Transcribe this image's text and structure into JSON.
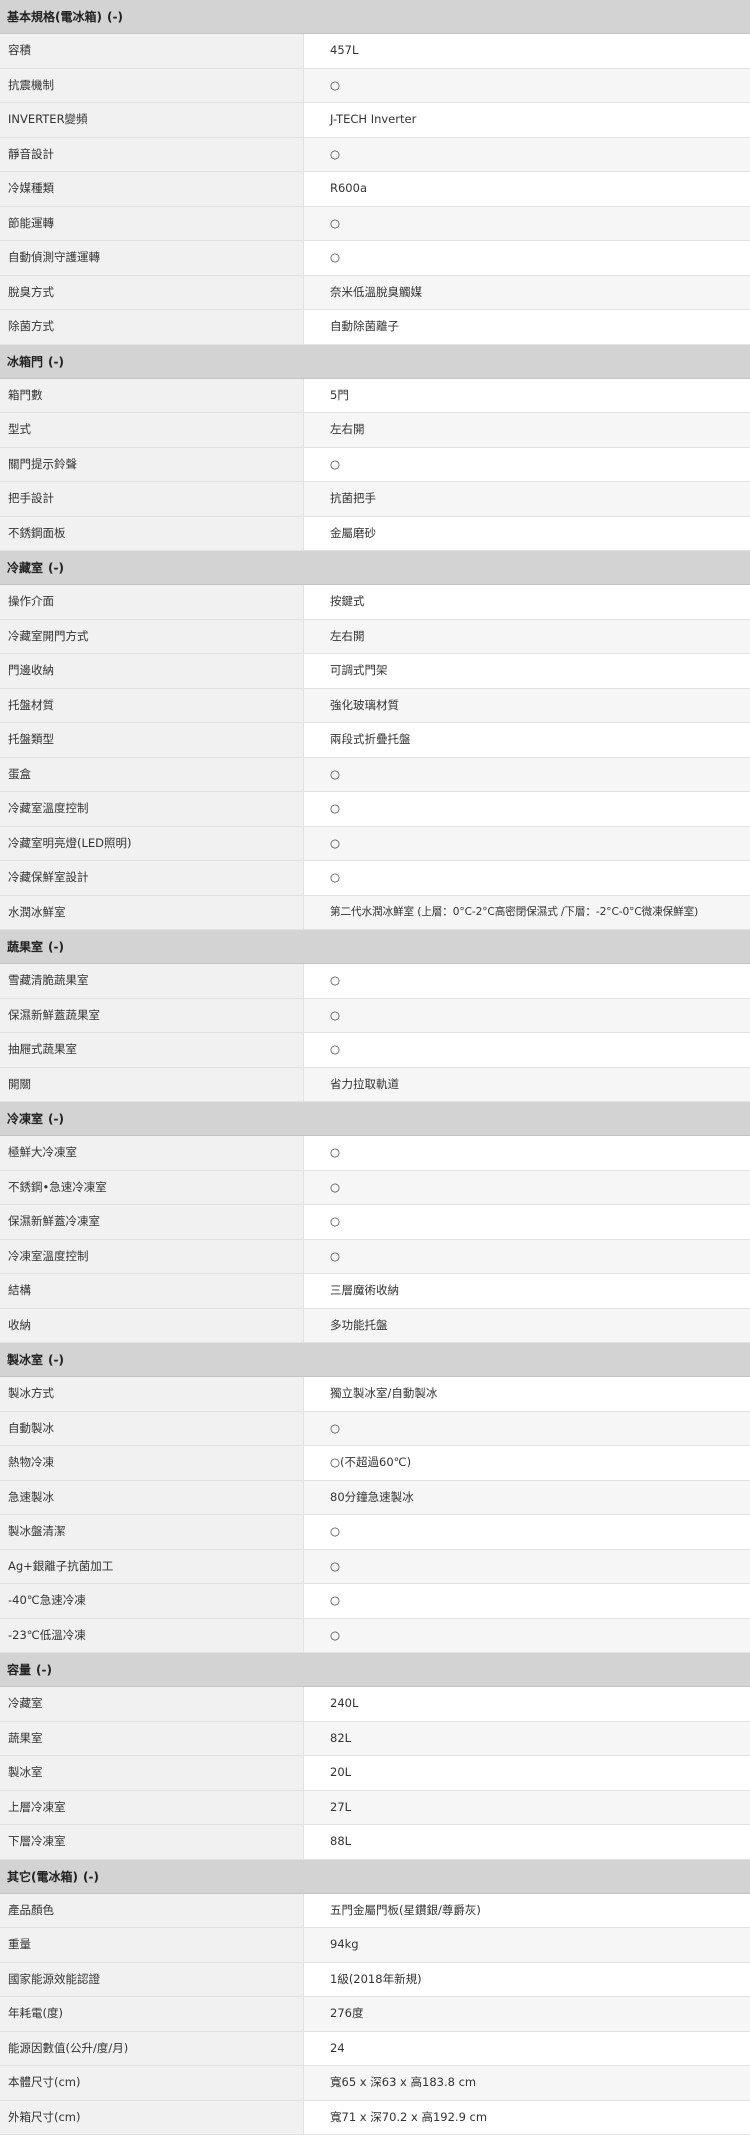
{
  "sections": [
    {
      "title": "基本規格(電冰箱)",
      "toggle": "(-)",
      "rows": [
        {
          "label": "容積",
          "value": "457L"
        },
        {
          "label": "抗震機制",
          "value": "○"
        },
        {
          "label": "INVERTER變頻",
          "value": "J-TECH Inverter"
        },
        {
          "label": "靜音設計",
          "value": "○"
        },
        {
          "label": "冷媒種類",
          "value": "R600a"
        },
        {
          "label": "節能運轉",
          "value": "○"
        },
        {
          "label": "自動偵測守護運轉",
          "value": "○"
        },
        {
          "label": "脫臭方式",
          "value": "奈米低溫脫臭觸媒"
        },
        {
          "label": "除菌方式",
          "value": "自動除菌離子"
        }
      ]
    },
    {
      "title": "冰箱門",
      "toggle": "(-)",
      "rows": [
        {
          "label": "箱門數",
          "value": "5門"
        },
        {
          "label": "型式",
          "value": "左右開"
        },
        {
          "label": "關門提示鈴聲",
          "value": "○"
        },
        {
          "label": "把手設計",
          "value": "抗菌把手"
        },
        {
          "label": "不銹鋼面板",
          "value": "金屬磨砂"
        }
      ]
    },
    {
      "title": "冷藏室",
      "toggle": "(-)",
      "rows": [
        {
          "label": "操作介面",
          "value": "按鍵式"
        },
        {
          "label": "冷藏室開門方式",
          "value": "左右開"
        },
        {
          "label": "門邊收納",
          "value": "可調式門架"
        },
        {
          "label": "托盤材質",
          "value": "強化玻璃材質"
        },
        {
          "label": "托盤類型",
          "value": "兩段式折疊托盤"
        },
        {
          "label": "蛋盒",
          "value": "○"
        },
        {
          "label": "冷藏室溫度控制",
          "value": "○"
        },
        {
          "label": "冷藏室明亮燈(LED照明)",
          "value": "○"
        },
        {
          "label": "冷藏保鮮室設計",
          "value": "○"
        },
        {
          "label": "水潤冰鮮室",
          "value": "第二代水潤冰鮮室 (上層：0°C-2°C高密閉保濕式 /下層：-2°C-0°C微凍保鮮室)"
        }
      ]
    },
    {
      "title": "蔬果室",
      "toggle": "(-)",
      "rows": [
        {
          "label": "雪藏清脆蔬果室",
          "value": "○"
        },
        {
          "label": "保濕新鮮蓋蔬果室",
          "value": "○"
        },
        {
          "label": "抽屜式蔬果室",
          "value": "○"
        },
        {
          "label": "開關",
          "value": "省力拉取軌道"
        }
      ]
    },
    {
      "title": "冷凍室",
      "toggle": "(-)",
      "rows": [
        {
          "label": "極鮮大冷凍室",
          "value": "○"
        },
        {
          "label": "不銹鋼•急速冷凍室",
          "value": "○"
        },
        {
          "label": "保濕新鮮蓋冷凍室",
          "value": "○"
        },
        {
          "label": "冷凍室溫度控制",
          "value": "○"
        },
        {
          "label": "結構",
          "value": "三層魔術收納"
        },
        {
          "label": "收納",
          "value": "多功能托盤"
        }
      ]
    },
    {
      "title": "製冰室",
      "toggle": "(-)",
      "rows": [
        {
          "label": "製冰方式",
          "value": "獨立製冰室/自動製冰"
        },
        {
          "label": "自動製冰",
          "value": "○"
        },
        {
          "label": "熱物冷凍",
          "value": "○(不超過60℃)"
        },
        {
          "label": "急速製冰",
          "value": "80分鐘急速製冰"
        },
        {
          "label": "製冰盤清潔",
          "value": "○"
        },
        {
          "label": "Ag+銀離子抗菌加工",
          "value": "○"
        },
        {
          "label": "-40℃急速冷凍",
          "value": "○"
        },
        {
          "label": "-23℃低溫冷凍",
          "value": "○"
        }
      ]
    },
    {
      "title": "容量",
      "toggle": "(-)",
      "rows": [
        {
          "label": "冷藏室",
          "value": "240L"
        },
        {
          "label": "蔬果室",
          "value": "82L"
        },
        {
          "label": "製冰室",
          "value": "20L"
        },
        {
          "label": "上層冷凍室",
          "value": "27L"
        },
        {
          "label": "下層冷凍室",
          "value": "88L"
        }
      ]
    },
    {
      "title": "其它(電冰箱)",
      "toggle": "(-)",
      "rows": [
        {
          "label": "產品顏色",
          "value": "五門金屬門板(星鑽銀/尊爵灰)"
        },
        {
          "label": "重量",
          "value": "94kg"
        },
        {
          "label": "國家能源效能認證",
          "value": "1級(2018年新規)"
        },
        {
          "label": "年耗電(度)",
          "value": "276度"
        },
        {
          "label": "能源因數值(公升/度/月)",
          "value": "24"
        },
        {
          "label": "本體尺寸(cm)",
          "value": "寬65 x 深63 x 高183.8 cm"
        },
        {
          "label": "外箱尺寸(cm)",
          "value": "寬71 x 深70.2 x 高192.9 cm"
        }
      ]
    }
  ]
}
